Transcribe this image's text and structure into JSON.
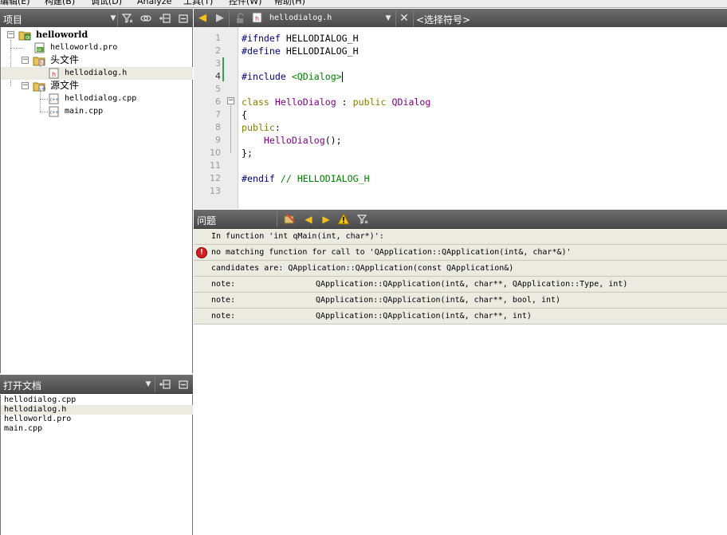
{
  "menubar": {
    "items": [
      "编辑(E)",
      "构建(B)",
      "调试(D)",
      "Analyze",
      "工具(T)",
      "控件(W)",
      "帮助(H)"
    ]
  },
  "project_panel": {
    "title": "项目",
    "tree": [
      {
        "label": "helloworld",
        "bold": true,
        "icon": "project-folder-icon"
      },
      {
        "label": "helloworld.pro",
        "icon": "pro-file-icon"
      },
      {
        "label": "头文件",
        "icon": "header-folder-icon"
      },
      {
        "label": "hellodialog.h",
        "icon": "header-file-icon",
        "selected": true
      },
      {
        "label": "源文件",
        "icon": "source-folder-icon"
      },
      {
        "label": "hellodialog.cpp",
        "icon": "cpp-file-icon"
      },
      {
        "label": "main.cpp",
        "icon": "cpp-file-icon"
      }
    ]
  },
  "open_docs": {
    "title": "打开文档",
    "items": [
      "hellodialog.cpp",
      "hellodialog.h",
      "helloworld.pro",
      "main.cpp"
    ],
    "selected_index": 1
  },
  "editor_toolbar": {
    "file_name": "hellodialog.h",
    "symbol_selector": "<选择符号>"
  },
  "editor": {
    "current_line": 4,
    "lines": [
      {
        "n": "1",
        "parts": [
          {
            "t": "#ifndef",
            "c": "kw-pre"
          },
          {
            "t": " HELLODIALOG_H",
            "c": ""
          }
        ]
      },
      {
        "n": "2",
        "parts": [
          {
            "t": "#define",
            "c": "kw-pre"
          },
          {
            "t": " HELLODIALOG_H",
            "c": ""
          }
        ]
      },
      {
        "n": "3",
        "parts": []
      },
      {
        "n": "4",
        "parts": [
          {
            "t": "#include",
            "c": "kw-pre"
          },
          {
            "t": " ",
            "c": ""
          },
          {
            "t": "<QDialog>",
            "c": "inc"
          }
        ]
      },
      {
        "n": "5",
        "parts": []
      },
      {
        "n": "6",
        "parts": [
          {
            "t": "class",
            "c": "kw"
          },
          {
            "t": " ",
            "c": ""
          },
          {
            "t": "HelloDialog",
            "c": "type"
          },
          {
            "t": " : ",
            "c": ""
          },
          {
            "t": "public",
            "c": "kw"
          },
          {
            "t": " ",
            "c": ""
          },
          {
            "t": "QDialog",
            "c": "type"
          }
        ]
      },
      {
        "n": "7",
        "parts": [
          {
            "t": "{",
            "c": ""
          }
        ]
      },
      {
        "n": "8",
        "parts": [
          {
            "t": "public",
            "c": "kw"
          },
          {
            "t": ":",
            "c": ""
          }
        ]
      },
      {
        "n": "9",
        "parts": [
          {
            "t": "    ",
            "c": ""
          },
          {
            "t": "HelloDialog",
            "c": "fn"
          },
          {
            "t": "();",
            "c": ""
          }
        ]
      },
      {
        "n": "10",
        "parts": [
          {
            "t": "};",
            "c": ""
          }
        ]
      },
      {
        "n": "11",
        "parts": []
      },
      {
        "n": "12",
        "parts": [
          {
            "t": "#endif",
            "c": "kw-pre"
          },
          {
            "t": " ",
            "c": ""
          },
          {
            "t": "// HELLODIALOG_H",
            "c": "cmt"
          }
        ]
      },
      {
        "n": "13",
        "parts": []
      }
    ]
  },
  "issues_panel": {
    "title": "问题",
    "rows": [
      {
        "message": "In function 'int qMain(int, char*)':",
        "detail": "",
        "error": false
      },
      {
        "message": "no matching function for call to 'QApplication::QApplication(int&, char*&)'",
        "detail": "",
        "error": true
      },
      {
        "message": "candidates are: QApplication::QApplication(const QApplication&)",
        "detail": "",
        "error": false
      },
      {
        "message": "note:",
        "detail": "QApplication::QApplication(int&, char**, QApplication::Type, int)",
        "error": false
      },
      {
        "message": "note:",
        "detail": "QApplication::QApplication(int&, char**, bool, int)",
        "error": false
      },
      {
        "message": "note:",
        "detail": "QApplication::QApplication(int&, char**, int)",
        "error": false
      }
    ]
  }
}
